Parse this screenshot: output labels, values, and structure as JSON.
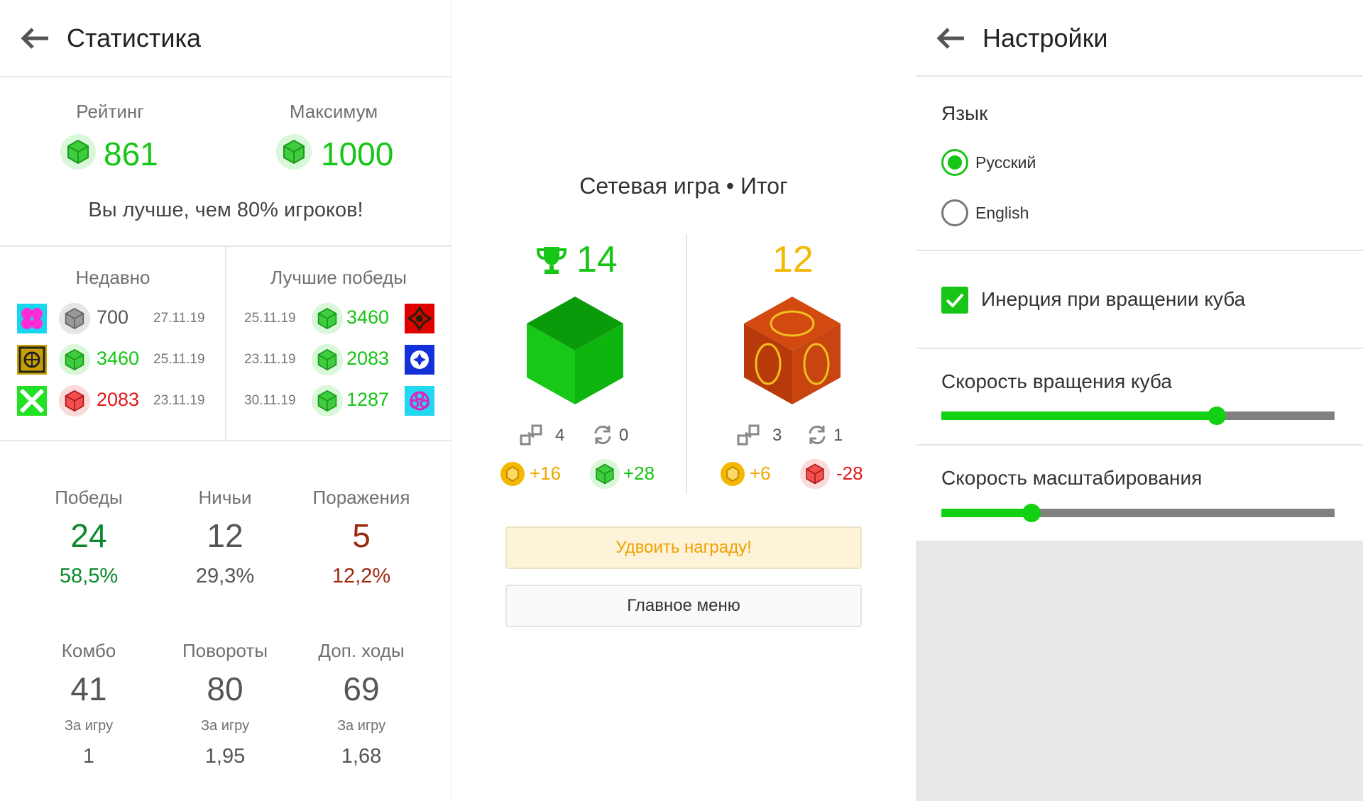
{
  "stats": {
    "title": "Статистика",
    "rating_label": "Рейтинг",
    "rating_value": "861",
    "max_label": "Максимум",
    "max_value": "1000",
    "better_than": "Вы лучше, чем 80% игроков!",
    "recent_label": "Недавно",
    "recent": [
      {
        "value": "700",
        "date": "27.11.19",
        "color": "gray"
      },
      {
        "value": "3460",
        "date": "25.11.19",
        "color": "green"
      },
      {
        "value": "2083",
        "date": "23.11.19",
        "color": "red"
      }
    ],
    "best_label": "Лучшие победы",
    "best": [
      {
        "date": "25.11.19",
        "value": "3460"
      },
      {
        "date": "23.11.19",
        "value": "2083"
      },
      {
        "date": "30.11.19",
        "value": "1287"
      }
    ],
    "results": [
      {
        "label": "Победы",
        "value": "24",
        "pct": "58,5%"
      },
      {
        "label": "Ничьи",
        "value": "12",
        "pct": "29,3%"
      },
      {
        "label": "Поражения",
        "value": "5",
        "pct": "12,2%"
      }
    ],
    "moves": [
      {
        "label": "Комбо",
        "value": "41",
        "per_label": "За игру",
        "per_value": "1"
      },
      {
        "label": "Повороты",
        "value": "80",
        "per_label": "За игру",
        "per_value": "1,95"
      },
      {
        "label": "Доп. ходы",
        "value": "69",
        "per_label": "За игру",
        "per_value": "1,68"
      }
    ]
  },
  "result": {
    "title": "Сетевая игра • Итог",
    "player1": {
      "score": "14",
      "moves": "4",
      "rotations": "0",
      "coins": "+16",
      "rating": "+28"
    },
    "player2": {
      "score": "12",
      "moves": "3",
      "rotations": "1",
      "coins": "+6",
      "rating": "-28"
    },
    "double_button": "Удвоить награду!",
    "menu_button": "Главное меню"
  },
  "settings": {
    "title": "Настройки",
    "language_label": "Язык",
    "lang_options": [
      "Русский",
      "English"
    ],
    "selected_language": "Русский",
    "inertia_label": "Инерция при вращении куба",
    "inertia_checked": true,
    "rotation_speed_label": "Скорость вращения куба",
    "rotation_speed": 0.7,
    "zoom_speed_label": "Скорость масштабирования",
    "zoom_speed": 0.23
  },
  "colors": {
    "accent_green": "#16c516",
    "loss_red": "#e01818",
    "gold": "#f5b800"
  }
}
